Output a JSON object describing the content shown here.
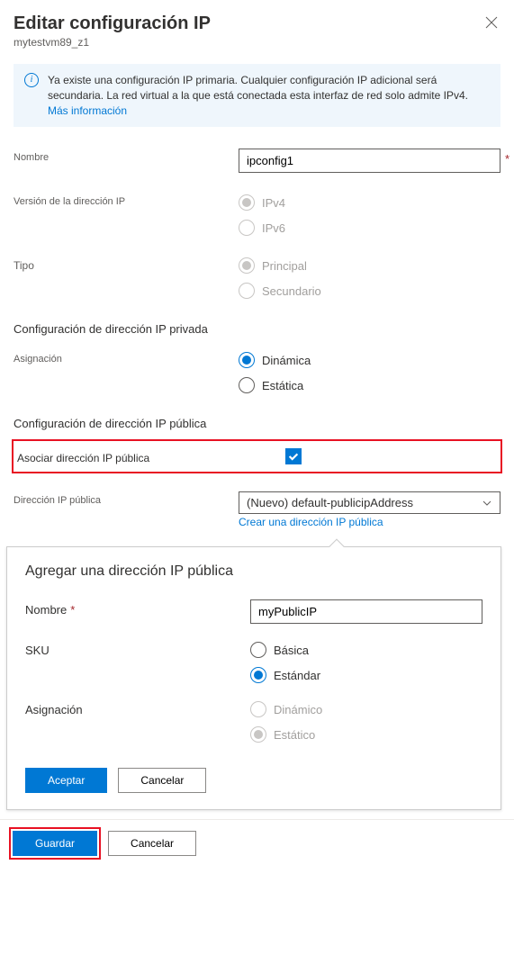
{
  "header": {
    "title": "Editar configuración IP",
    "subtitle": "mytestvm89_z1"
  },
  "info": {
    "text": "Ya existe una configuración IP primaria. Cualquier configuración IP adicional será secundaria. La red virtual a la que está conectada esta interfaz de red solo admite IPv4. ",
    "more": "Más información"
  },
  "labels": {
    "name": "Nombre",
    "ipVersion": "Versión de la dirección IP",
    "type": "Tipo",
    "privateConfig": "Configuración de dirección IP privada",
    "assignment": "Asignación",
    "publicConfig": "Configuración de dirección IP pública",
    "associatePublic": "Asociar dirección IP pública",
    "publicIp": "Dirección IP pública",
    "createLink": "Crear una dirección IP pública"
  },
  "values": {
    "name": "ipconfig1",
    "ipVersion": {
      "v4": "IPv4",
      "v6": "IPv6"
    },
    "type": {
      "primary": "Principal",
      "secondary": "Secundario"
    },
    "assignment": {
      "dynamic": "Dinámica",
      "static": "Estática"
    },
    "publicIpSelected": "(Nuevo) default-publicipAddress"
  },
  "callout": {
    "title": "Agregar una dirección IP pública",
    "nameLabel": "Nombre",
    "nameValue": "myPublicIP",
    "skuLabel": "SKU",
    "sku": {
      "basic": "Básica",
      "standard": "Estándar"
    },
    "assignLabel": "Asignación",
    "assign": {
      "dynamic": "Dinámico",
      "static": "Estático"
    },
    "ok": "Aceptar",
    "cancel": "Cancelar"
  },
  "footer": {
    "save": "Guardar",
    "cancel": "Cancelar"
  }
}
